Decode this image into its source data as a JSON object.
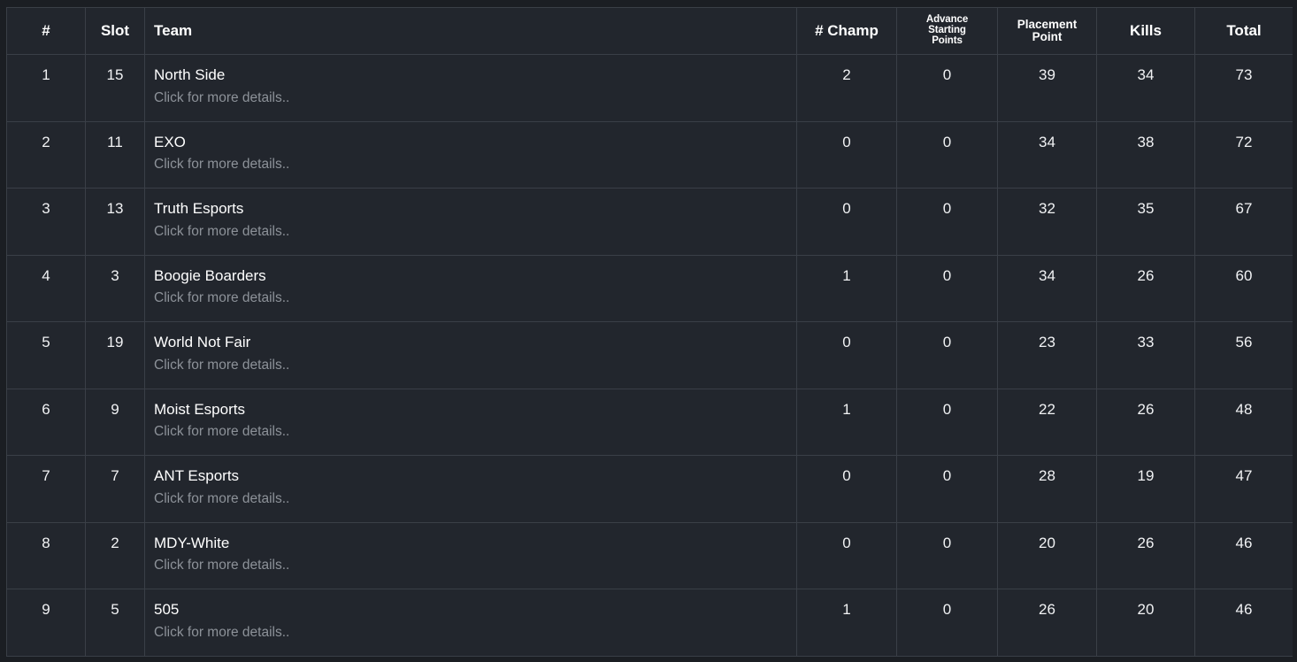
{
  "table": {
    "columns": [
      {
        "key": "rank",
        "label": "#",
        "align": "center"
      },
      {
        "key": "slot",
        "label": "Slot",
        "align": "center"
      },
      {
        "key": "team",
        "label": "Team",
        "align": "left"
      },
      {
        "key": "champ",
        "label": "# Champ",
        "align": "center"
      },
      {
        "key": "advance",
        "label": "Advance Starting Points",
        "lines": [
          "Advance",
          "Starting",
          "Points"
        ],
        "align": "center"
      },
      {
        "key": "placement",
        "label": "Placement Point",
        "lines": [
          "Placement",
          "Point"
        ],
        "align": "center"
      },
      {
        "key": "kills",
        "label": "Kills",
        "align": "center"
      },
      {
        "key": "total",
        "label": "Total",
        "align": "center"
      }
    ],
    "row_subtitle": "Click for more details..",
    "rows": [
      {
        "rank": "1",
        "slot": "15",
        "team": "North Side",
        "champ": "2",
        "advance": "0",
        "placement": "39",
        "kills": "34",
        "total": "73"
      },
      {
        "rank": "2",
        "slot": "11",
        "team": "EXO",
        "champ": "0",
        "advance": "0",
        "placement": "34",
        "kills": "38",
        "total": "72"
      },
      {
        "rank": "3",
        "slot": "13",
        "team": "Truth Esports",
        "champ": "0",
        "advance": "0",
        "placement": "32",
        "kills": "35",
        "total": "67"
      },
      {
        "rank": "4",
        "slot": "3",
        "team": "Boogie Boarders",
        "champ": "1",
        "advance": "0",
        "placement": "34",
        "kills": "26",
        "total": "60"
      },
      {
        "rank": "5",
        "slot": "19",
        "team": "World Not Fair",
        "champ": "0",
        "advance": "0",
        "placement": "23",
        "kills": "33",
        "total": "56"
      },
      {
        "rank": "6",
        "slot": "9",
        "team": "Moist Esports",
        "champ": "1",
        "advance": "0",
        "placement": "22",
        "kills": "26",
        "total": "48"
      },
      {
        "rank": "7",
        "slot": "7",
        "team": "ANT Esports",
        "champ": "0",
        "advance": "0",
        "placement": "28",
        "kills": "19",
        "total": "47"
      },
      {
        "rank": "8",
        "slot": "2",
        "team": "MDY-White",
        "champ": "0",
        "advance": "0",
        "placement": "20",
        "kills": "26",
        "total": "46"
      },
      {
        "rank": "9",
        "slot": "5",
        "team": "505",
        "champ": "1",
        "advance": "0",
        "placement": "26",
        "kills": "20",
        "total": "46"
      }
    ]
  },
  "colors": {
    "page_background": "#1b1e23",
    "cell_background": "#22262d",
    "border": "#3a3f47",
    "text_primary": "#ffffff",
    "text_muted": "#8d9299"
  }
}
